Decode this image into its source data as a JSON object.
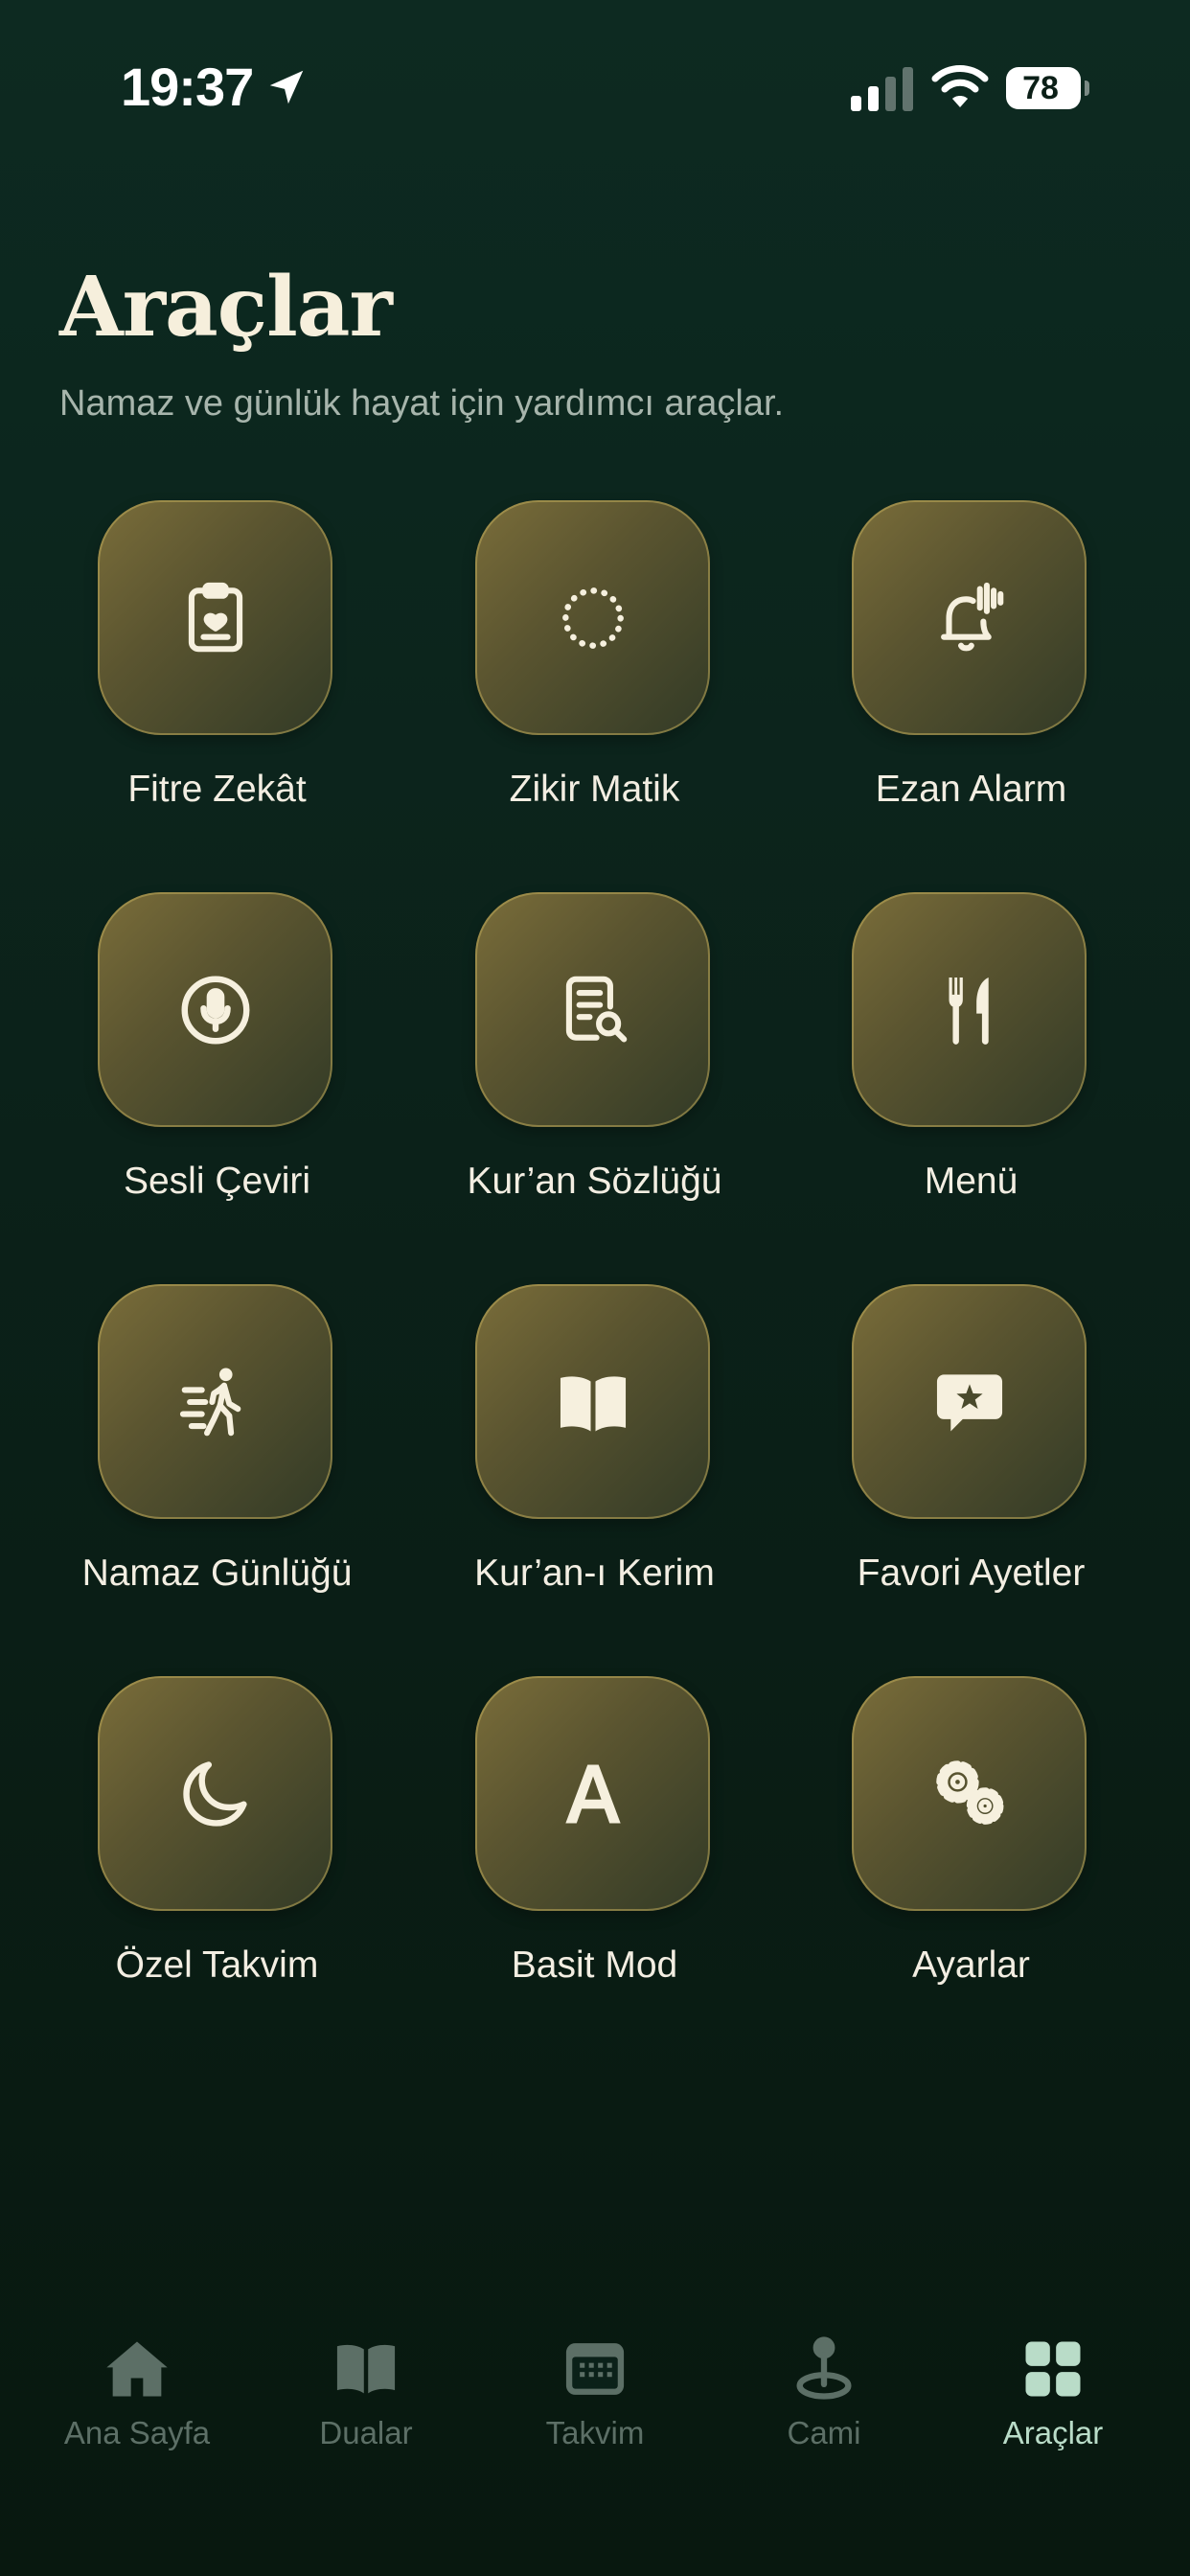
{
  "status_bar": {
    "time": "19:37",
    "battery": "78"
  },
  "header": {
    "title": "Araçlar",
    "subtitle": "Namaz ve günlük hayat için yardımcı araçlar."
  },
  "tools": [
    {
      "label": "Fitre Zekât",
      "icon": "clipboard-heart-icon"
    },
    {
      "label": "Zikir Matik",
      "icon": "dotted-circle-icon"
    },
    {
      "label": "Ezan Alarm",
      "icon": "bell-wave-icon"
    },
    {
      "label": "Sesli Çeviri",
      "icon": "microphone-icon"
    },
    {
      "label": "Kur’an Sözlüğü",
      "icon": "document-search-icon"
    },
    {
      "label": "Menü",
      "icon": "fork-knife-icon"
    },
    {
      "label": "Namaz Günlüğü",
      "icon": "walking-person-icon"
    },
    {
      "label": "Kur’an-ı Kerim",
      "icon": "open-book-icon"
    },
    {
      "label": "Favori Ayetler",
      "icon": "star-bubble-icon"
    },
    {
      "label": "Özel Takvim",
      "icon": "moon-icon"
    },
    {
      "label": "Basit Mod",
      "icon": "letter-a-icon"
    },
    {
      "label": "Ayarlar",
      "icon": "gears-icon"
    }
  ],
  "tab_bar": {
    "items": [
      {
        "label": "Ana Sayfa",
        "icon": "home-icon",
        "active": false
      },
      {
        "label": "Dualar",
        "icon": "book-icon",
        "active": false
      },
      {
        "label": "Takvim",
        "icon": "calendar-icon",
        "active": false
      },
      {
        "label": "Cami",
        "icon": "location-pin-icon",
        "active": false
      },
      {
        "label": "Araçlar",
        "icon": "grid-icon",
        "active": true
      }
    ]
  },
  "colors": {
    "background": "#0b2119",
    "tile_gold": "#7a6d3a",
    "text_primary": "#f4eee0",
    "tab_inactive": "#5c6f66",
    "tab_active": "#b9dcc8"
  }
}
